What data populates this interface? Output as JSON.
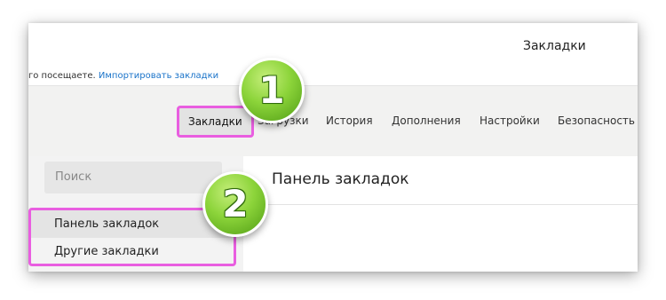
{
  "header": {
    "title": "Закладки",
    "promo_text": "го посещаете.",
    "import_link": "Импортировать закладки"
  },
  "nav": {
    "tabs": [
      {
        "label": "Закладки",
        "active": true
      },
      {
        "label": "Загрузки"
      },
      {
        "label": "История"
      },
      {
        "label": "Дополнения"
      },
      {
        "label": "Настройки"
      },
      {
        "label": "Безопасность"
      }
    ]
  },
  "sidebar": {
    "search_placeholder": "Поиск",
    "items": [
      {
        "label": "Панель закладок",
        "selected": true
      },
      {
        "label": "Другие закладки"
      }
    ]
  },
  "main": {
    "title": "Панель закладок"
  },
  "annotations": {
    "badge_1": "1",
    "badge_2": "2"
  },
  "colors": {
    "highlight": "#e95ee0",
    "link": "#1a73c9",
    "badge_green": "#8cd43a"
  }
}
